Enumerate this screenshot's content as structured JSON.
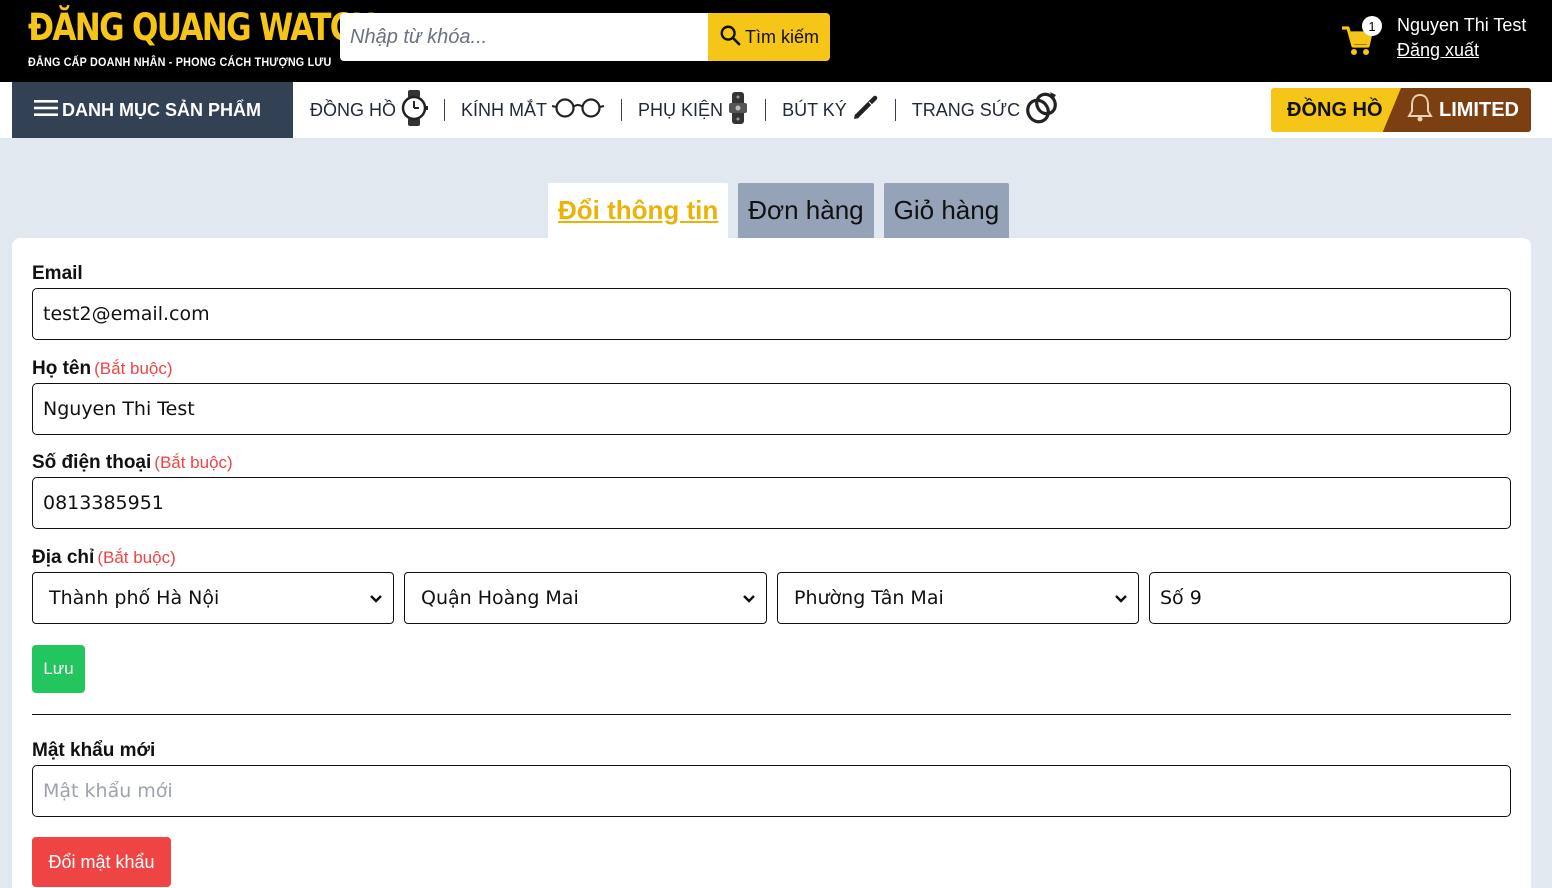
{
  "brand": {
    "name": "ĐĂNG QUANG WATCH",
    "tagline": "ĐẲNG CẤP DOANH NHÂN - PHONG CÁCH THƯỢNG LƯU",
    "accent_color": "#f5c518"
  },
  "search": {
    "placeholder": "Nhập từ khóa...",
    "button_label": "Tìm kiếm"
  },
  "cart": {
    "count": "1"
  },
  "user": {
    "name": "Nguyen Thi Test",
    "logout_label": "Đăng xuất"
  },
  "nav": {
    "category_label": "DANH MỤC SẢN PHẨM",
    "items": [
      {
        "label": "ĐỒNG HỒ",
        "icon": "watch-icon"
      },
      {
        "label": "KÍNH MẮT",
        "icon": "glasses-icon"
      },
      {
        "label": "PHỤ KIỆN",
        "icon": "watch-strap-icon"
      },
      {
        "label": "BÚT KÝ",
        "icon": "pen-icon"
      },
      {
        "label": "TRANG SỨC",
        "icon": "ring-icon"
      }
    ],
    "promo": {
      "left": "ĐỒNG HỒ",
      "right": "LIMITED",
      "icon": "bell-icon"
    }
  },
  "tabs": [
    {
      "label": "Đổi thông tin",
      "active": true
    },
    {
      "label": "Đơn hàng",
      "active": false
    },
    {
      "label": "Giỏ hàng",
      "active": false
    }
  ],
  "form": {
    "email_label": "Email",
    "email_value": "test2@email.com",
    "name_label": "Họ tên",
    "name_value": "Nguyen Thi Test",
    "phone_label": "Số điện thoại",
    "phone_value": "0813385951",
    "address_label": "Địa chỉ",
    "required_label": "(Bắt buộc)",
    "city_value": "Thành phố Hà Nội",
    "district_value": "Quận Hoàng Mai",
    "ward_value": "Phường Tân Mai",
    "street_value": "Số 9",
    "save_label": "Lưu",
    "new_password_label": "Mật khẩu mới",
    "new_password_placeholder": "Mật khẩu mới",
    "change_password_label": "Đổi mật khẩu"
  }
}
